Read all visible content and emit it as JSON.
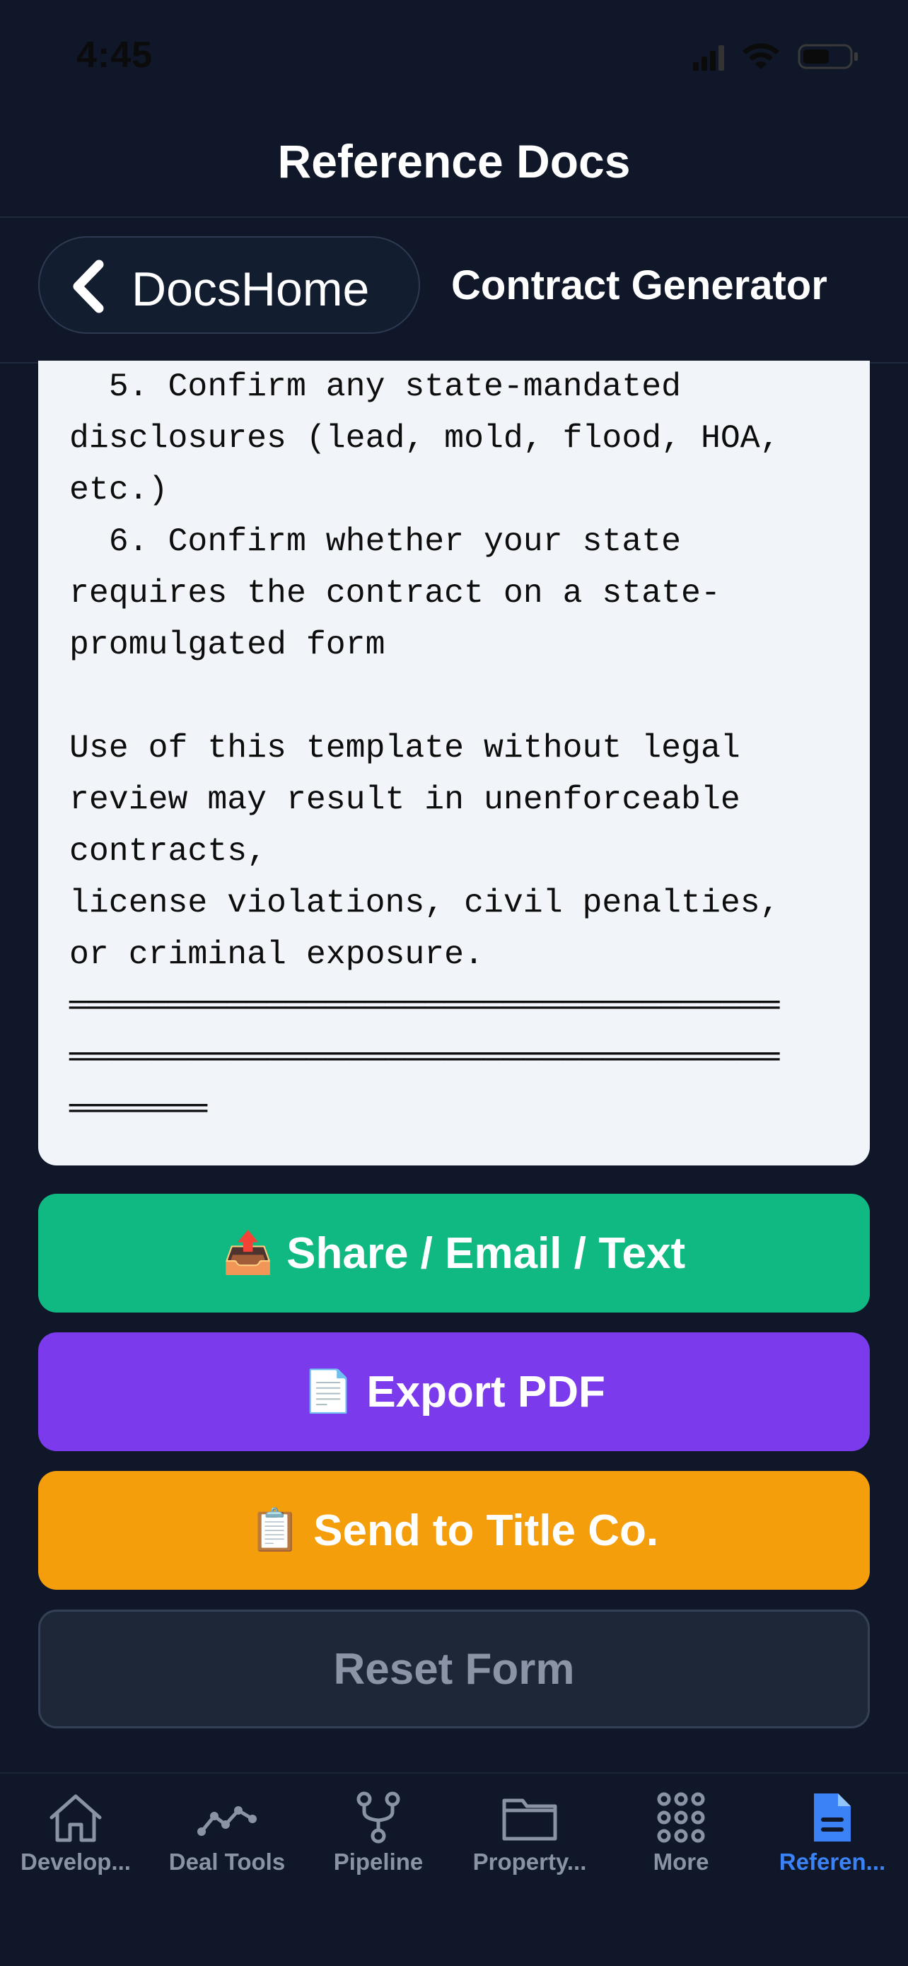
{
  "status_bar": {
    "time": "4:45"
  },
  "header": {
    "title": "Reference Docs"
  },
  "nav": {
    "back_label": "DocsHome",
    "title": "Contract Generator"
  },
  "document": {
    "text": "  5. Confirm any state-mandated\ndisclosures (lead, mold, flood, HOA,\netc.)\n  6. Confirm whether your state\nrequires the contract on a state-\npromulgated form\n\nUse of this template without legal\nreview may result in unenforceable\ncontracts,\nlicense violations, civil penalties,\nor criminal exposure.\n════════════════════════════════════\n════════════════════════════════════\n═══════"
  },
  "actions": {
    "share": {
      "emoji": "📤",
      "label": "Share / Email / Text"
    },
    "export": {
      "emoji": "📄",
      "label": "Export PDF"
    },
    "title_co": {
      "emoji": "📋",
      "label": "Send to Title Co."
    },
    "reset": {
      "label": "Reset Form"
    }
  },
  "tabs": [
    {
      "label": "Develop...",
      "icon": "home-icon"
    },
    {
      "label": "Deal Tools",
      "icon": "chart-line-icon"
    },
    {
      "label": "Pipeline",
      "icon": "branch-icon"
    },
    {
      "label": "Property...",
      "icon": "folder-icon"
    },
    {
      "label": "More",
      "icon": "grid-icon"
    },
    {
      "label": "Referen...",
      "icon": "document-icon",
      "active": true
    }
  ],
  "colors": {
    "background": "#0f1729",
    "share": "#10b981",
    "export": "#7c3aed",
    "title_co": "#f59e0b",
    "reset": "#1e2738",
    "active_tab": "#3b82f6"
  }
}
